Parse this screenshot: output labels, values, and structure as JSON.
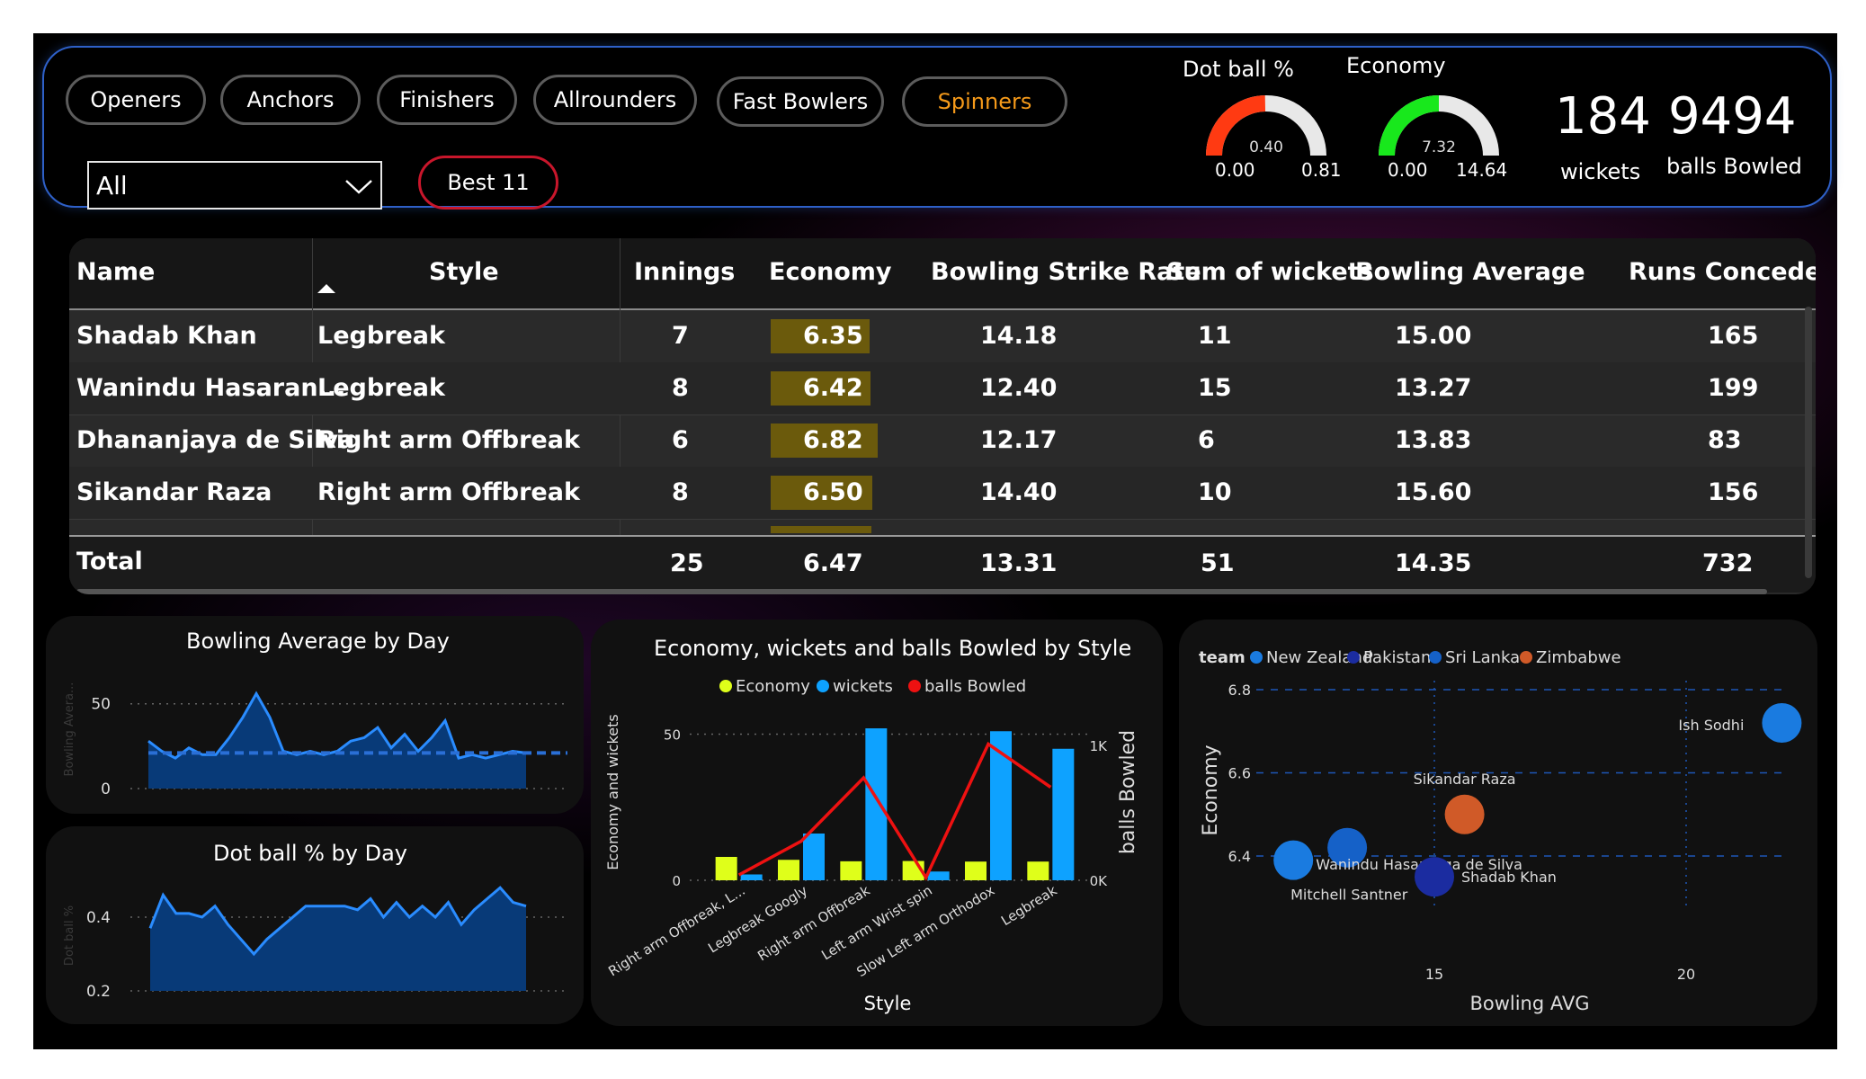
{
  "filters": {
    "buttons": [
      {
        "label": "Openers"
      },
      {
        "label": "Anchors"
      },
      {
        "label": "Finishers"
      },
      {
        "label": "Allrounders"
      },
      {
        "label": "Fast Bowlers"
      },
      {
        "label": "Spinners"
      }
    ],
    "active": "Spinners",
    "dropdown_value": "All",
    "best_label": "Best 11"
  },
  "gauges": {
    "dot_ball": {
      "title": "Dot ball %",
      "value": 0.4,
      "value_label": "0.40",
      "min": "0.00",
      "max": "0.81",
      "color": "#ff3a12"
    },
    "economy": {
      "title": "Economy",
      "value": 7.32,
      "value_label": "7.32",
      "min": "0.00",
      "max": "14.64",
      "color": "#18e81c"
    }
  },
  "kpis": {
    "wickets": {
      "value": "184",
      "label": "wickets"
    },
    "balls": {
      "value": "9494",
      "label": "balls Bowled"
    }
  },
  "table": {
    "columns": [
      "Name",
      "Style",
      "Innings",
      "Economy",
      "Bowling Strike Rate",
      "Sum of wickets",
      "Bowling Average",
      "Runs Conceded"
    ],
    "rows": [
      {
        "name": "Shadab Khan",
        "style": "Legbreak",
        "innings": "7",
        "economy": "6.35",
        "eco": 6.35,
        "sr": "14.18",
        "wickets": "11",
        "avg": "15.00",
        "runs": "165"
      },
      {
        "name": "Wanindu Hasaran...",
        "style": "Legbreak",
        "innings": "8",
        "economy": "6.42",
        "eco": 6.42,
        "sr": "12.40",
        "wickets": "15",
        "avg": "13.27",
        "runs": "199"
      },
      {
        "name": "Dhananjaya de Silva",
        "style": "Right arm Offbreak",
        "innings": "6",
        "economy": "6.82",
        "eco": 6.82,
        "sr": "12.17",
        "wickets": "6",
        "avg": "13.83",
        "runs": "83"
      },
      {
        "name": "Sikandar Raza",
        "style": "Right arm Offbreak",
        "innings": "8",
        "economy": "6.50",
        "eco": 6.5,
        "sr": "14.40",
        "wickets": "10",
        "avg": "15.60",
        "runs": "156"
      }
    ],
    "total": {
      "name": "Total",
      "innings": "25",
      "economy": "6.47",
      "sr": "13.31",
      "wickets": "51",
      "avg": "14.35",
      "runs": "732"
    }
  },
  "chart_data": [
    {
      "type": "area",
      "title": "Bowling Average by Day",
      "ylabel": "Bowling Avera...",
      "yticks": [
        "50",
        "0"
      ],
      "ylim": [
        0,
        70
      ],
      "reference": 21,
      "values": [
        28,
        22,
        18,
        24,
        20,
        20,
        30,
        42,
        56,
        42,
        22,
        20,
        22,
        20,
        22,
        28,
        30,
        36,
        24,
        32,
        22,
        30,
        40,
        18,
        20,
        18,
        20,
        22,
        21
      ]
    },
    {
      "type": "area",
      "title": "Dot ball % by Day",
      "ylabel": "Dot ball %",
      "yticks": [
        "0.4",
        "0.2"
      ],
      "ylim": [
        0.2,
        0.5
      ],
      "values": [
        0.37,
        0.46,
        0.41,
        0.41,
        0.4,
        0.43,
        0.38,
        0.34,
        0.3,
        0.34,
        0.37,
        0.4,
        0.43,
        0.43,
        0.43,
        0.43,
        0.42,
        0.45,
        0.4,
        0.44,
        0.4,
        0.43,
        0.4,
        0.44,
        0.38,
        0.42,
        0.45,
        0.48,
        0.44,
        0.43
      ]
    },
    {
      "type": "bar",
      "title": "Economy, wickets and balls Bowled by Style",
      "xlabel": "Style",
      "ylabel": "Economy and wickets",
      "y2label": "balls Bowled",
      "categories": [
        "Right arm Offbreak, L...",
        "Legbreak Googly",
        "Right arm Offbreak",
        "Left arm Wrist spin",
        "Slow Left arm Orthodox",
        "Legbreak"
      ],
      "ylim": [
        0,
        60
      ],
      "y2lim": [
        0,
        1300
      ],
      "yticks": [
        "50",
        "0"
      ],
      "y2ticks": [
        "1K",
        "0K"
      ],
      "legend": [
        "Economy",
        "wickets",
        "balls Bowled"
      ],
      "colors": {
        "Economy": "#dfff1a",
        "wickets": "#0ea2ff",
        "balls Bowled": "#ee1111"
      },
      "series": [
        {
          "name": "Economy",
          "values": [
            8,
            7,
            6.5,
            6.6,
            6.4,
            6.4
          ]
        },
        {
          "name": "wickets",
          "values": [
            2,
            16,
            52,
            3,
            51,
            45
          ]
        },
        {
          "name": "balls Bowled",
          "values": [
            40,
            290,
            760,
            20,
            1010,
            690
          ]
        }
      ]
    },
    {
      "type": "scatter",
      "xlabel": "Bowling AVG",
      "ylabel": "Economy",
      "legend_title": "team",
      "legend": [
        {
          "name": "New Zealand",
          "color": "#1a7be0"
        },
        {
          "name": "Pakistan",
          "color": "#1b2ca0"
        },
        {
          "name": "Sri Lanka",
          "color": "#1561c8"
        },
        {
          "name": "Zimbabwe",
          "color": "#d05a28"
        }
      ],
      "xlim": [
        12,
        22
      ],
      "ylim": [
        6.32,
        6.8
      ],
      "xticks": [
        "15",
        "20"
      ],
      "yticks": [
        "6.8",
        "6.6",
        "6.4"
      ],
      "points": [
        {
          "name": "Ish Sodhi",
          "team": "New Zealand",
          "x": 21.9,
          "y": 6.72,
          "r": 22
        },
        {
          "name": "Sikandar Raza",
          "team": "Zimbabwe",
          "x": 15.6,
          "y": 6.5,
          "r": 22
        },
        {
          "name": "Wanindu Hasaranga de Silva",
          "team": "Sri Lanka",
          "x": 13.27,
          "y": 6.42,
          "r": 22
        },
        {
          "name": "Mitchell Santner",
          "team": "New Zealand",
          "x": 12.2,
          "y": 6.39,
          "r": 22
        },
        {
          "name": "Shadab Khan",
          "team": "Pakistan",
          "x": 15.0,
          "y": 6.35,
          "r": 22
        }
      ]
    }
  ]
}
